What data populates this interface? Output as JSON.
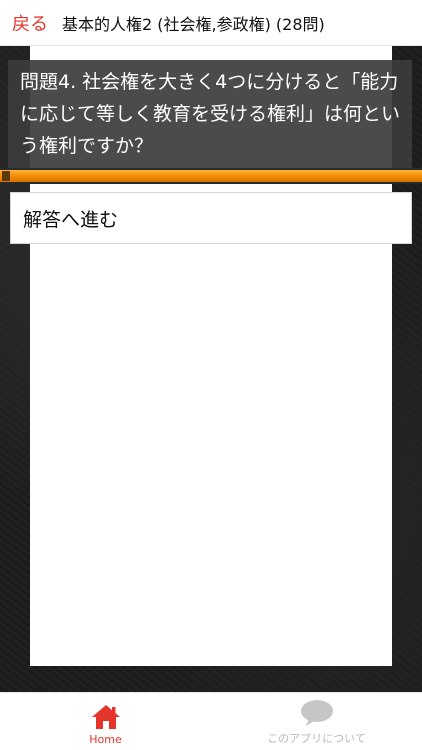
{
  "header": {
    "back_label": "戻る",
    "title": "基本的人権2 (社会権,参政権) (28問)"
  },
  "question": {
    "text": "問題4. 社会権を大きく4つに分けると「能力に応じて等しく教育を受ける権利」は何という権利ですか？"
  },
  "progress": {
    "fraction": 1.0
  },
  "answer_button": {
    "label": "解答へ進む"
  },
  "tabs": [
    {
      "label": "Home",
      "icon": "home-icon",
      "active": true
    },
    {
      "label": "このアプリについて",
      "icon": "speech-bubble-icon",
      "active": false
    }
  ],
  "colors": {
    "accent": "#e5352b",
    "progress": "#f28a00",
    "inactive": "#b8b8b8"
  }
}
